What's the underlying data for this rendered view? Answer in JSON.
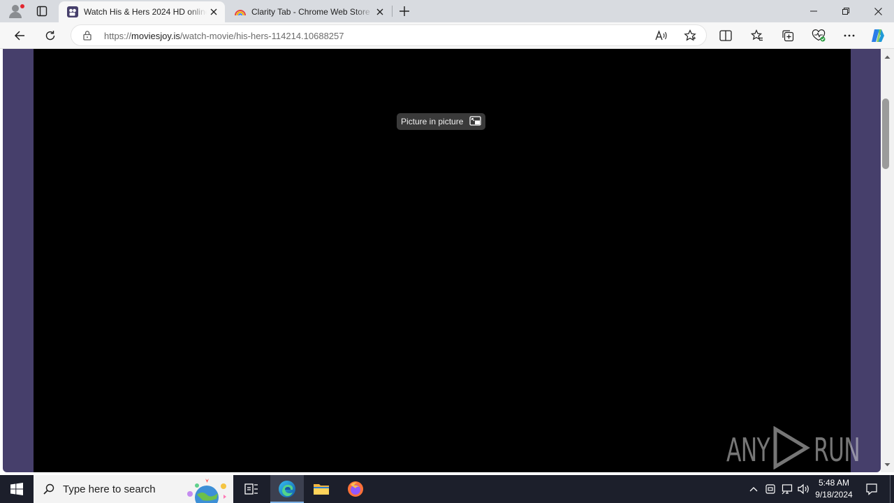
{
  "browser": {
    "tabs": [
      {
        "title": "Watch His & Hers 2024 HD online",
        "favicon": "movie-reel-icon",
        "active": true
      },
      {
        "title": "Clarity Tab - Chrome Web Store",
        "favicon": "rainbow-icon",
        "active": false
      }
    ],
    "address": {
      "protocol": "https://",
      "host": "moviesjoy.is",
      "path": "/watch-movie/his-hers-114214.10688257"
    }
  },
  "page": {
    "overlay": {
      "pip_label": "Picture in picture"
    },
    "watermark": "ANY RUN",
    "colors": {
      "frame": "#463f6b",
      "player": "#000000"
    }
  },
  "taskbar": {
    "search_placeholder": "Type here to search",
    "time": "5:48 AM",
    "date": "9/18/2024"
  }
}
